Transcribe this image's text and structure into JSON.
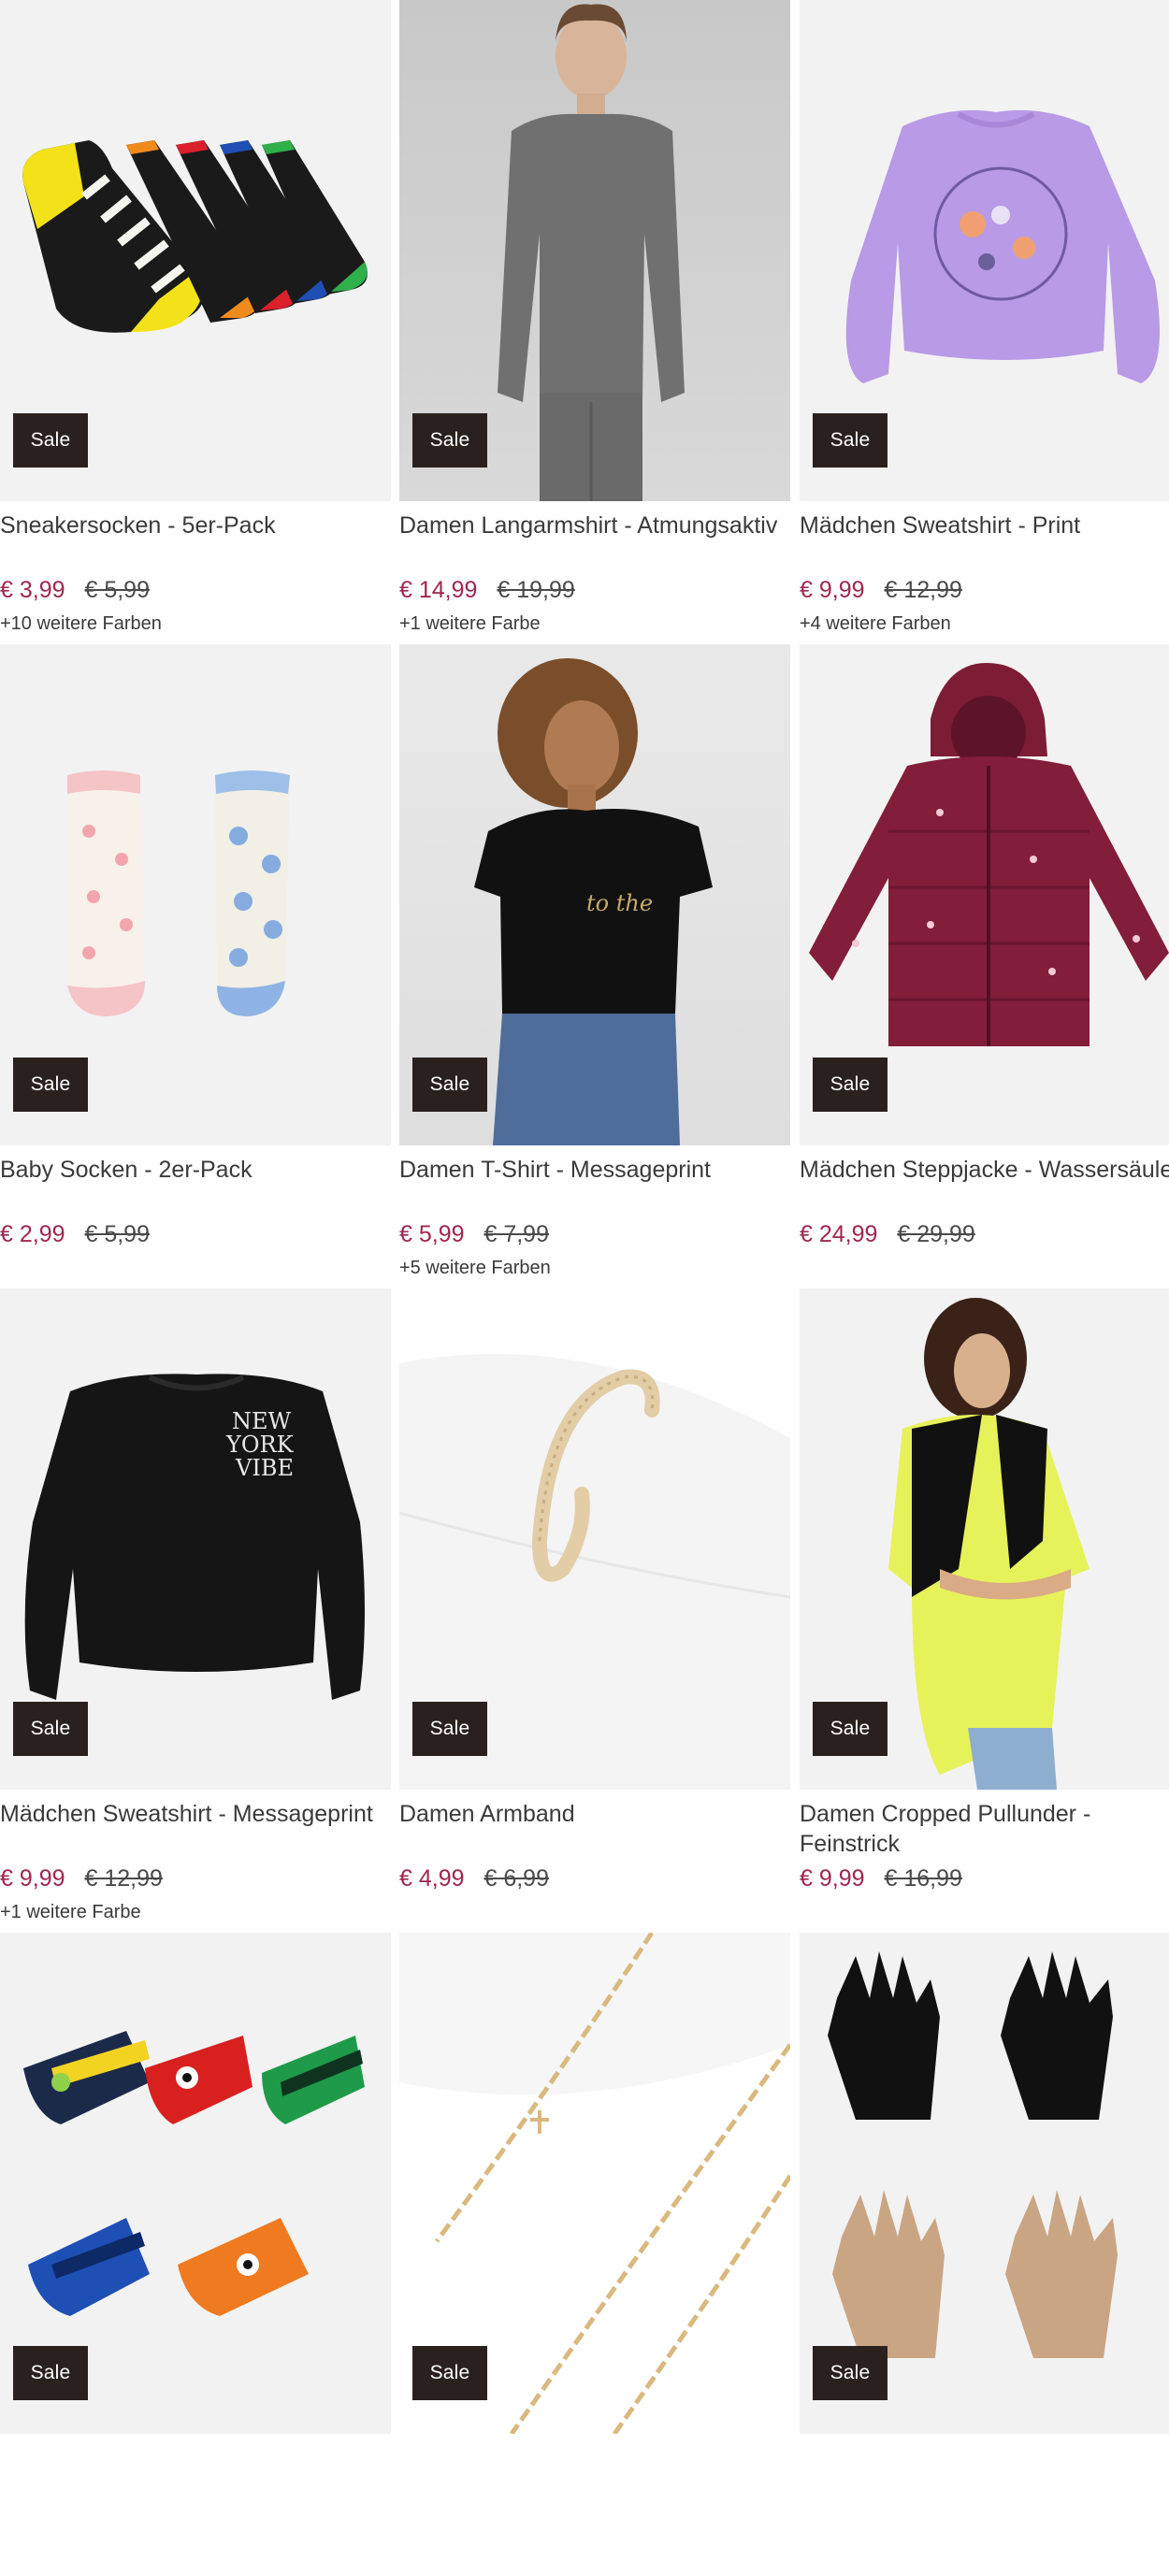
{
  "badge_label": "Sale",
  "colors": {
    "price": "#a0264f",
    "badge_bg": "#2a211f",
    "image_bg": "#f2f2f2"
  },
  "products": [
    {
      "title": "Sneakersocken - 5er-Pack",
      "price": "€ 3,99",
      "old_price": "€ 5,99",
      "colors": "+10 weitere Farben",
      "image": "striped-ankle-socks-image"
    },
    {
      "title": "Damen Langarmshirt - Atmungsaktiv",
      "price": "€ 14,99",
      "old_price": "€ 19,99",
      "colors": "+1 weitere Farbe",
      "image": "gray-longsleeve-model-image"
    },
    {
      "title": "Mädchen Sweatshirt - Print",
      "price": "€ 9,99",
      "old_price": "€ 12,99",
      "colors": "+4 weitere Farben",
      "image": "lilac-sweatshirt-image"
    },
    {
      "title": "Baby Socken - 2er-Pack",
      "price": "€ 2,99",
      "old_price": "€ 5,99",
      "colors": "",
      "image": "baby-socks-image"
    },
    {
      "title": "Damen T-Shirt - Messageprint",
      "price": "€ 5,99",
      "old_price": "€ 7,99",
      "colors": "+5 weitere Farben",
      "image": "black-tshirt-model-image"
    },
    {
      "title": "Mädchen Steppjacke - Wassersäule",
      "price": "€ 24,99",
      "old_price": "€ 29,99",
      "colors": "",
      "image": "burgundy-puffer-jacket-image"
    },
    {
      "title": "Mädchen Sweatshirt - Messageprint",
      "price": "€ 9,99",
      "old_price": "€ 12,99",
      "colors": "+1 weitere Farbe",
      "image": "black-sweatshirt-image"
    },
    {
      "title": "Damen Armband",
      "price": "€ 4,99",
      "old_price": "€ 6,99",
      "colors": "",
      "image": "rope-bracelet-image"
    },
    {
      "title": "Damen Cropped Pullunder - Feinstrick",
      "price": "€ 9,99",
      "old_price": "€ 16,99",
      "colors": "",
      "image": "cropped-knit-vest-model-image"
    },
    {
      "title": "",
      "price": "",
      "old_price": "",
      "colors": "",
      "image": "monster-kids-socks-image"
    },
    {
      "title": "",
      "price": "",
      "old_price": "",
      "colors": "",
      "image": "gold-chain-necklaces-image"
    },
    {
      "title": "",
      "price": "",
      "old_price": "",
      "colors": "",
      "image": "knit-gloves-image"
    }
  ]
}
